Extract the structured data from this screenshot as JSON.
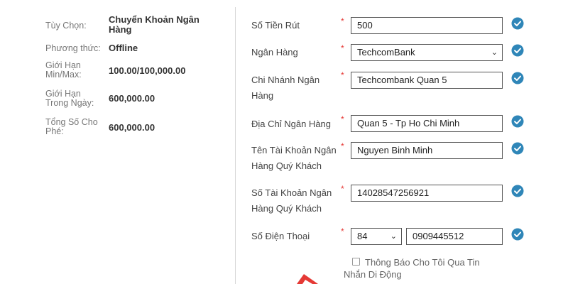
{
  "left_info": {
    "rows": [
      {
        "label": "Tùy Chọn:",
        "value": "Chuyển Khoản Ngân Hàng"
      },
      {
        "label": "Phương thức:",
        "value": "Offline"
      },
      {
        "label": "Giới Hạn Min/Max:",
        "value": "100.00/100,000.00"
      },
      {
        "label": "Giới Hạn Trong Ngày:",
        "value": "600,000.00"
      },
      {
        "label": "Tổng Số Cho Phé:",
        "value": "600,000.00"
      }
    ]
  },
  "form": {
    "required_mark": "*",
    "amount": {
      "label": "Số Tiền Rút",
      "value": "500"
    },
    "bank": {
      "label": "Ngân Hàng",
      "value": "TechcomBank"
    },
    "branch": {
      "label": "Chi Nhánh Ngân Hàng",
      "value": "Techcombank Quan 5"
    },
    "address": {
      "label": "Địa Chỉ Ngân Hàng",
      "value": "Quan 5 - Tp Ho Chi Minh"
    },
    "account_name": {
      "label": "Tên Tài Khoản Ngân Hàng Quý Khách",
      "value": "Nguyen Binh Minh"
    },
    "account_number": {
      "label": "Số Tài Khoản Ngân Hàng Quý Khách",
      "value": "14028547256921"
    },
    "phone": {
      "label": "Số Điện Thoại",
      "country_code": "84",
      "value": "0909445512"
    },
    "sms_notify": {
      "label": "Thông Báo Cho Tôi Qua Tin Nhắn Di Động",
      "checked": false
    }
  },
  "colors": {
    "check_icon": "#2f86b8",
    "required": "#e53935",
    "arrow": "#e53935"
  }
}
